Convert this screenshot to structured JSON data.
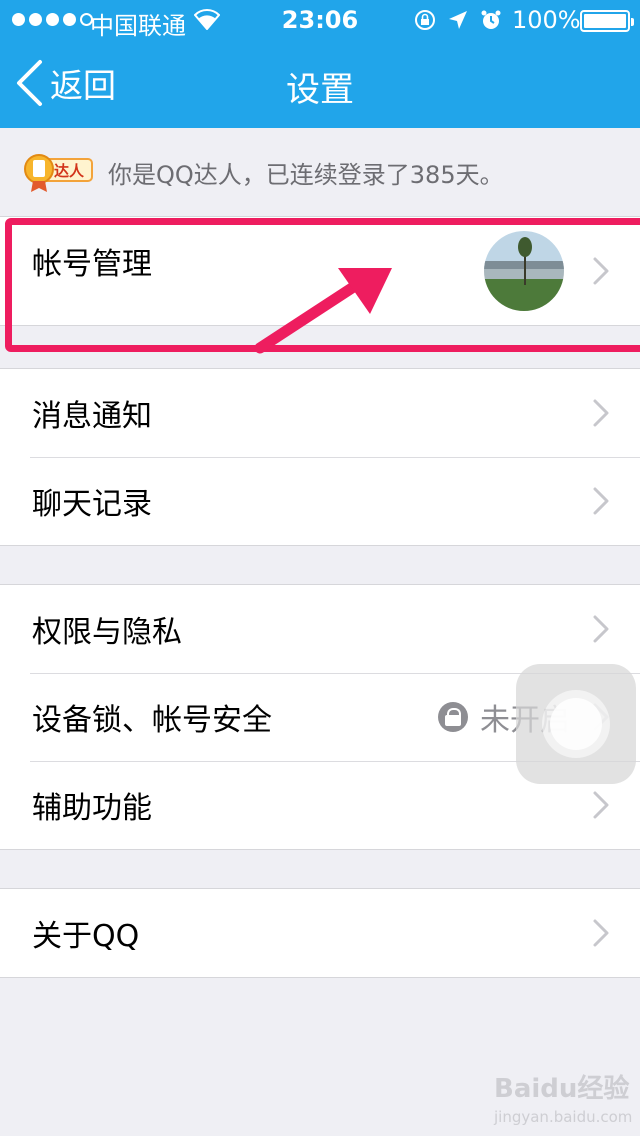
{
  "status_bar": {
    "carrier": "中国联通",
    "time": "23:06",
    "battery_percent": "100%"
  },
  "nav": {
    "back_label": "返回",
    "title": "设置"
  },
  "talent": {
    "badge_text": "达人",
    "text": "你是QQ达人，已连续登录了385天。"
  },
  "groups": [
    {
      "items": [
        {
          "label": "帐号管理"
        }
      ]
    },
    {
      "items": [
        {
          "label": "消息通知"
        },
        {
          "label": "聊天记录"
        }
      ]
    },
    {
      "items": [
        {
          "label": "权限与隐私"
        },
        {
          "label": "设备锁、帐号安全",
          "status": "未开启"
        },
        {
          "label": "辅助功能"
        }
      ]
    },
    {
      "items": [
        {
          "label": "关于QQ"
        }
      ]
    }
  ],
  "colors": {
    "nav_bar": "#21a5ea",
    "highlight": "#ee1d5f",
    "background": "#efeff4"
  },
  "watermark": {
    "brand": "Baidu经验",
    "url": "jingyan.baidu.com"
  }
}
